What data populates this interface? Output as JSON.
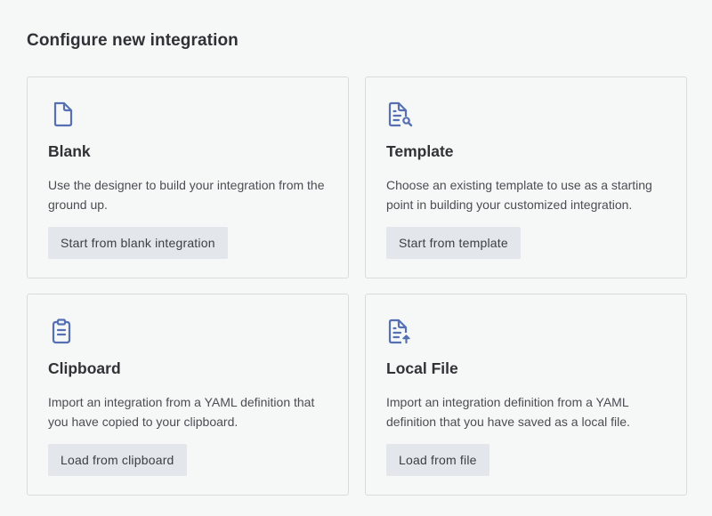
{
  "page": {
    "title": "Configure new integration"
  },
  "colors": {
    "icon": "#5670b3",
    "button_bg": "#e3e7eb",
    "card_border": "#d9dcdf",
    "background": "#f6f7f7"
  },
  "cards": [
    {
      "icon": "blank-document-icon",
      "title": "Blank",
      "description": "Use the designer to build your integration from the ground up.",
      "button_label": "Start from blank integration"
    },
    {
      "icon": "document-search-icon",
      "title": "Template",
      "description": "Choose an existing template to use as a starting point in building your customized integration.",
      "button_label": "Start from template"
    },
    {
      "icon": "clipboard-icon",
      "title": "Clipboard",
      "description": "Import an integration from a YAML definition that you have copied to your clipboard.",
      "button_label": "Load from clipboard"
    },
    {
      "icon": "document-upload-icon",
      "title": "Local File",
      "description": "Import an integration definition from a YAML definition that you have saved as a local file.",
      "button_label": "Load from file"
    }
  ]
}
